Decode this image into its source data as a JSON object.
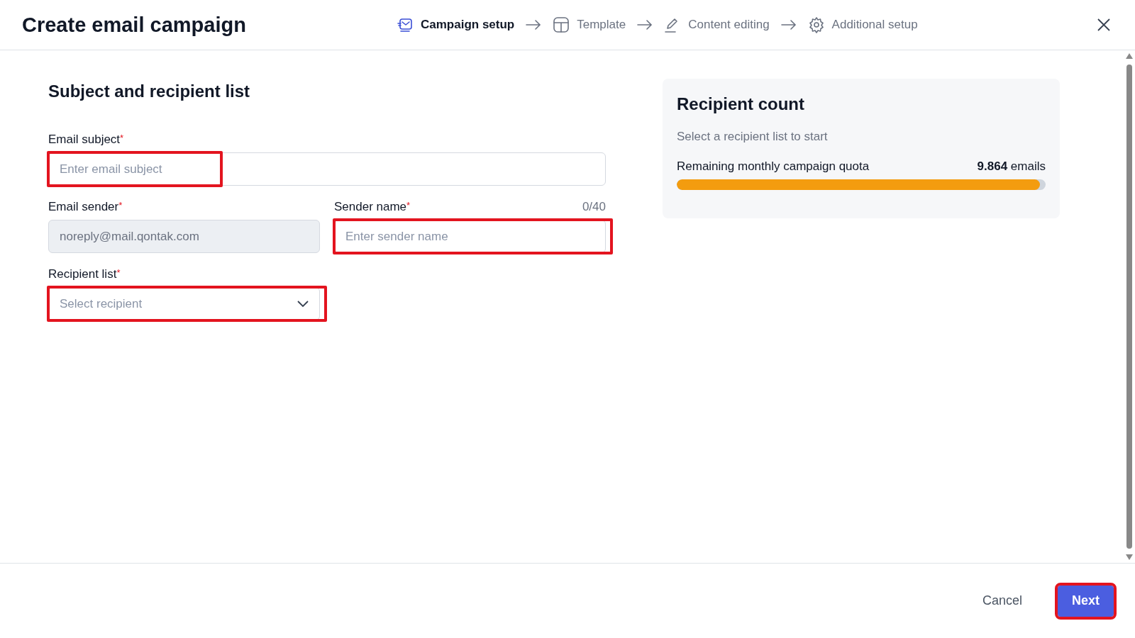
{
  "header": {
    "title": "Create email campaign",
    "steps": [
      {
        "label": "Campaign setup",
        "selected": true
      },
      {
        "label": "Template",
        "selected": false
      },
      {
        "label": "Content editing",
        "selected": false
      },
      {
        "label": "Additional setup",
        "selected": false
      }
    ]
  },
  "form": {
    "heading": "Subject and recipient list",
    "rows": [
      [
        {
          "kind": "text",
          "label": "Email subject",
          "required_mark": "*",
          "placeholder": "Enter email subject",
          "highlighted": true
        }
      ],
      [
        {
          "kind": "text",
          "label": "Email sender",
          "required_mark": "*",
          "value": "noreply@mail.qontak.com",
          "disabled": true,
          "highlighted": false
        },
        {
          "kind": "text",
          "label": "Sender name",
          "required_mark": "*",
          "counter": "0/40",
          "placeholder": "Enter sender name",
          "highlighted": true
        }
      ],
      [
        {
          "kind": "select",
          "label": "Recipient list",
          "required_mark": "*",
          "placeholder": "Select recipient",
          "highlighted": true
        }
      ]
    ]
  },
  "summary": {
    "title": "Recipient count",
    "hint": "Select a recipient list to start",
    "quota_label": "Remaining monthly campaign quota",
    "quota_value": "**9.864** emails",
    "level": 0.985
  },
  "footer": {
    "buttons": [
      {
        "label": "Cancel",
        "kind": "text",
        "highlighted": false
      },
      {
        "label": "Next",
        "kind": "primary",
        "highlighted": true
      }
    ]
  }
}
